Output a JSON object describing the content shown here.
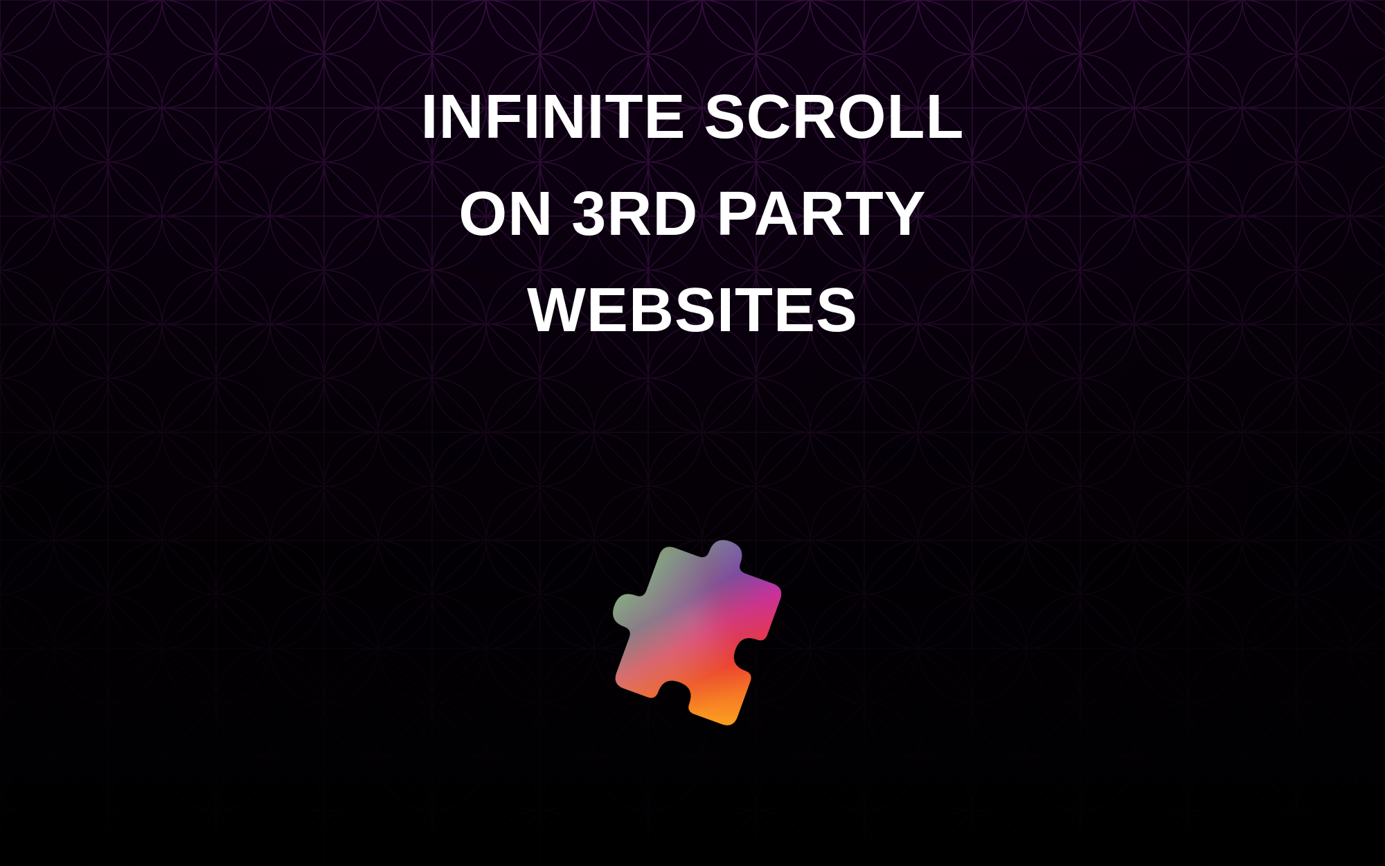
{
  "heading": {
    "line1": "INFINITE SCROLL",
    "line2": "ON 3RD PARTY",
    "line3": "WEBSITES"
  },
  "icon": {
    "name": "puzzle-piece"
  },
  "colors": {
    "pattern_stroke": "#5a1a6a",
    "gradient_top": "#2a0036",
    "gradient_bottom": "#000000",
    "text": "#ffffff"
  }
}
